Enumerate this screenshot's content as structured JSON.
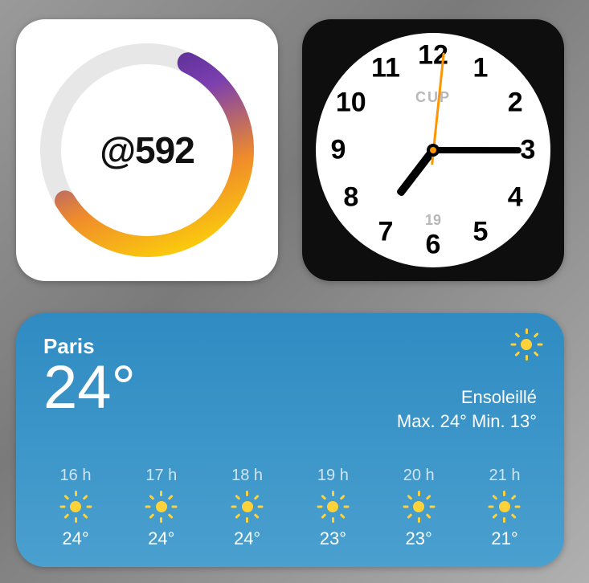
{
  "ring": {
    "label": "@592",
    "progress_percent": 59.2
  },
  "clock": {
    "city": "CUP",
    "bottom_label": "19",
    "hour": 7,
    "minute": 15,
    "second": 1,
    "numerals": [
      "12",
      "1",
      "2",
      "3",
      "4",
      "5",
      "6",
      "7",
      "8",
      "9",
      "10",
      "11"
    ]
  },
  "weather": {
    "city": "Paris",
    "temp": "24°",
    "condition": "Ensoleillé",
    "hi_lo": "Max. 24° Min. 13°",
    "now_icon": "sun-icon",
    "hourly": [
      {
        "label": "16 h",
        "icon": "sun-icon",
        "temp": "24°"
      },
      {
        "label": "17 h",
        "icon": "sun-icon",
        "temp": "24°"
      },
      {
        "label": "18 h",
        "icon": "sun-icon",
        "temp": "24°"
      },
      {
        "label": "19 h",
        "icon": "sun-icon",
        "temp": "23°"
      },
      {
        "label": "20 h",
        "icon": "sun-icon",
        "temp": "23°"
      },
      {
        "label": "21 h",
        "icon": "sun-icon",
        "temp": "21°"
      }
    ]
  }
}
